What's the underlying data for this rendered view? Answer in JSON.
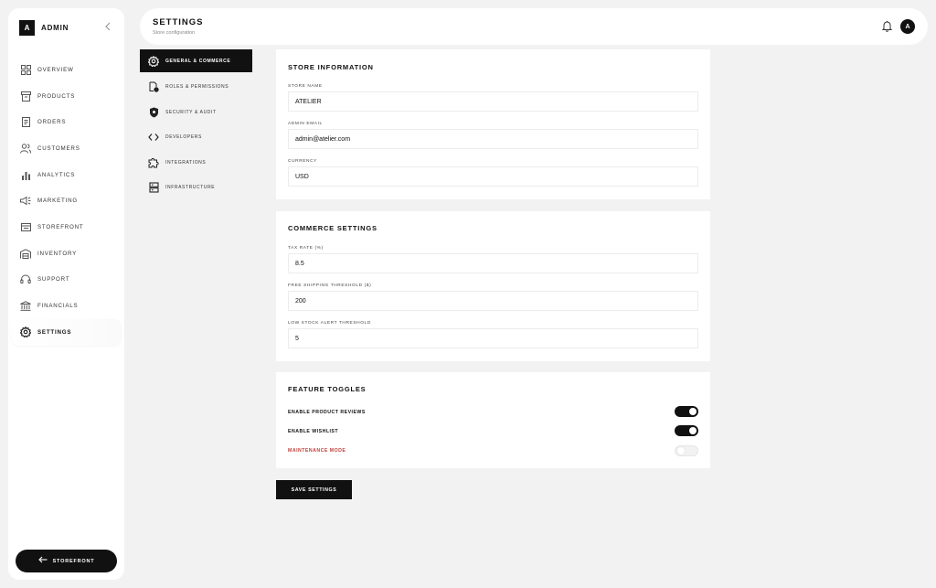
{
  "brand": {
    "letter": "A",
    "name": "ADMIN"
  },
  "sidebar": {
    "items": [
      {
        "label": "OVERVIEW",
        "icon": "grid-icon"
      },
      {
        "label": "PRODUCTS",
        "icon": "box-icon"
      },
      {
        "label": "ORDERS",
        "icon": "clipboard-icon"
      },
      {
        "label": "CUSTOMERS",
        "icon": "users-icon"
      },
      {
        "label": "ANALYTICS",
        "icon": "bar-chart-icon"
      },
      {
        "label": "MARKETING",
        "icon": "megaphone-icon"
      },
      {
        "label": "STOREFRONT",
        "icon": "storefront-icon"
      },
      {
        "label": "INVENTORY",
        "icon": "warehouse-icon"
      },
      {
        "label": "SUPPORT",
        "icon": "headset-icon"
      },
      {
        "label": "FINANCIALS",
        "icon": "bank-icon"
      },
      {
        "label": "SETTINGS",
        "icon": "gear-icon",
        "active": true
      }
    ],
    "storefront_button": "STOREFRONT"
  },
  "header": {
    "title": "SETTINGS",
    "subtitle": "Store configuration",
    "avatar": "A"
  },
  "subnav": {
    "items": [
      {
        "label": "GENERAL & COMMERCE",
        "icon": "gear-icon",
        "active": true
      },
      {
        "label": "ROLES & PERMISSIONS",
        "icon": "user-lock-icon"
      },
      {
        "label": "SECURITY & AUDIT",
        "icon": "shield-icon"
      },
      {
        "label": "DEVELOPERS",
        "icon": "code-icon"
      },
      {
        "label": "INTEGRATIONS",
        "icon": "puzzle-icon"
      },
      {
        "label": "INFRASTRUCTURE",
        "icon": "server-icon"
      }
    ]
  },
  "store_info": {
    "title": "STORE INFORMATION",
    "store_name_label": "STORE NAME",
    "store_name": "ATELIER",
    "admin_email_label": "ADMIN EMAIL",
    "admin_email": "admin@atelier.com",
    "currency_label": "CURRENCY",
    "currency": "USD"
  },
  "commerce": {
    "title": "COMMERCE SETTINGS",
    "tax_rate_label": "TAX RATE (%)",
    "tax_rate": "8.5",
    "free_shipping_label": "FREE SHIPPING THRESHOLD ($)",
    "free_shipping": "200",
    "low_stock_label": "LOW STOCK ALERT THRESHOLD",
    "low_stock": "5"
  },
  "features": {
    "title": "FEATURE TOGGLES",
    "toggles": [
      {
        "label": "ENABLE PRODUCT REVIEWS",
        "on": true
      },
      {
        "label": "ENABLE WISHLIST",
        "on": true
      },
      {
        "label": "MAINTENANCE MODE",
        "on": false,
        "color": "#c0413b"
      }
    ]
  },
  "save_button": "SAVE SETTINGS"
}
